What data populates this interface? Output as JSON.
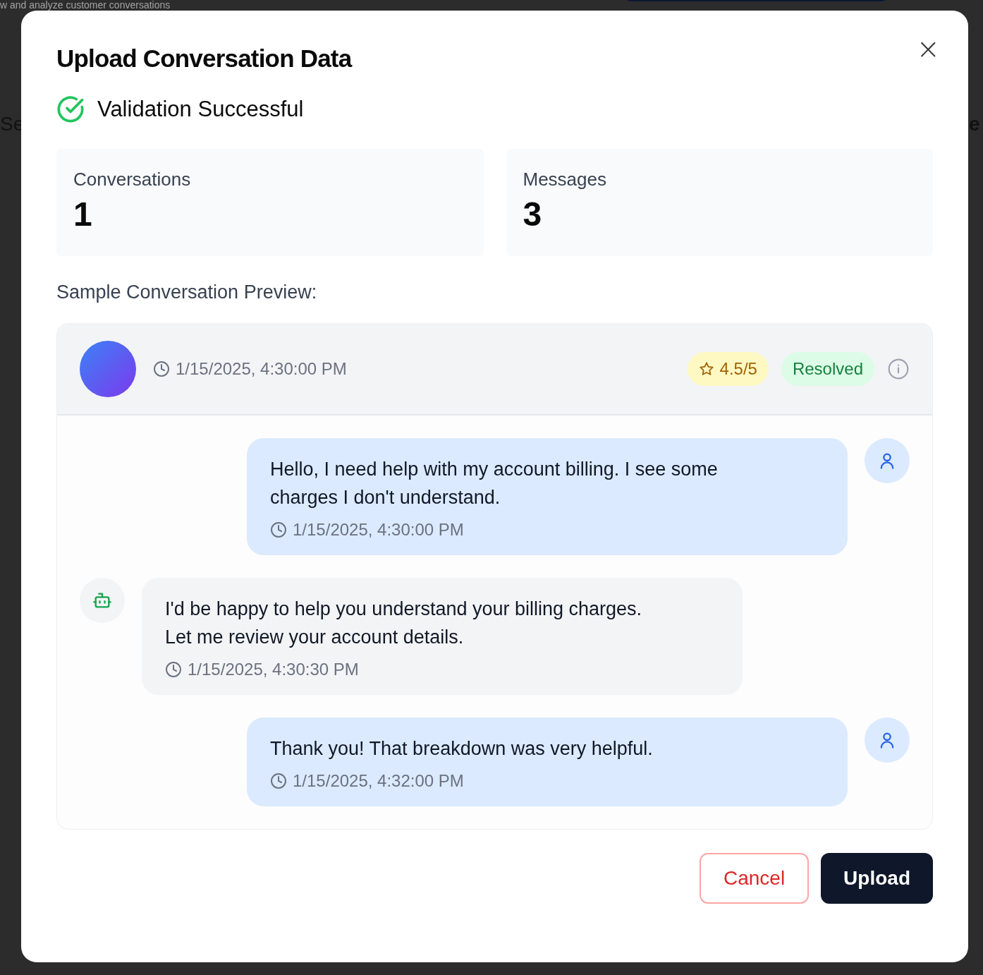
{
  "background": {
    "subtitle": "w and analyze customer conversations",
    "left_fragment": "Se",
    "right_fragment": "e"
  },
  "dialog": {
    "title": "Upload Conversation Data",
    "close": "×",
    "validation": {
      "passed": true,
      "text": "Validation Successful"
    }
  },
  "stats": [
    {
      "label": "Conversations",
      "value": "1"
    },
    {
      "label": "Messages",
      "value": "3"
    }
  ],
  "preview": {
    "heading": "Sample Conversation Preview:",
    "timestamp": "1/15/2025, 4:30:00 PM",
    "rating": "4.5/5",
    "status": {
      "label": "Resolved",
      "color": "#15803d"
    },
    "messages": [
      {
        "kind": "user",
        "text": "Hello, I need help with my account billing. I see some charges I don't understand.",
        "time": "1/15/2025, 4:30:00 PM"
      },
      {
        "kind": "assistant",
        "text": "I'd be happy to help you understand your billing charges. Let me review your account details.",
        "time": "1/15/2025, 4:30:30 PM"
      },
      {
        "kind": "user",
        "text": "Thank you! That breakdown was very helpful.",
        "time": "1/15/2025, 4:32:00 PM"
      }
    ]
  },
  "buttons": [
    {
      "kind": "cancel",
      "label": "Cancel"
    },
    {
      "kind": "primary",
      "label": "Upload"
    }
  ]
}
